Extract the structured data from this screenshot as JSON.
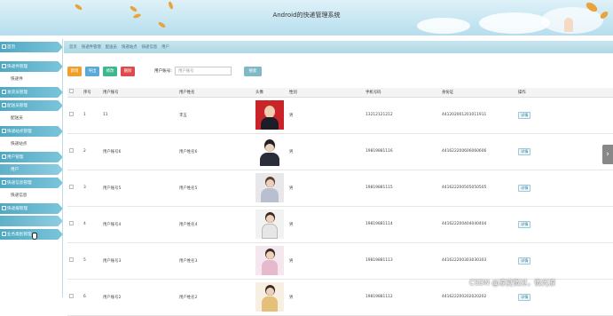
{
  "header": {
    "title": "Android的快递管理系统"
  },
  "sidebar": {
    "groups": [
      {
        "label": "首页",
        "items": []
      },
      {
        "label": "快递件管理",
        "items": [
          "快递件"
        ]
      },
      {
        "label": "发货员管理",
        "items": []
      },
      {
        "label": "配送员管理",
        "items": [
          "配送员"
        ]
      },
      {
        "label": "快递站点管理",
        "items": [
          "快递站点"
        ]
      },
      {
        "label": "用户管理",
        "items": [
          "用户"
        ]
      },
      {
        "label": "快递信息管理",
        "items": [
          "快递信息"
        ]
      },
      {
        "label": "快递报管理",
        "items": [
          ""
        ]
      },
      {
        "label": "业务类别管理",
        "items": []
      }
    ]
  },
  "breadcrumb": [
    "首页",
    "快递件管理",
    "配送员",
    "快递站点",
    "快递信息",
    "用户"
  ],
  "toolbar": {
    "buttons": [
      {
        "label": "新增",
        "color": "#f0a028"
      },
      {
        "label": "导出",
        "color": "#5aa9d6"
      },
      {
        "label": "修改",
        "color": "#3cb88c"
      },
      {
        "label": "删除",
        "color": "#e04a4a"
      }
    ],
    "search_label": "用户账号:",
    "search_placeholder": "用户账号",
    "search_button": "搜索"
  },
  "table": {
    "columns": [
      "",
      "序号",
      "用户账号",
      "用户姓名",
      "头像",
      "性别",
      "手机号码",
      "身份证",
      "操作"
    ],
    "rows": [
      {
        "no": "1",
        "account": "11",
        "name": "李五",
        "gender": "男",
        "phone": "13212121212",
        "idcard": "441202001201011911",
        "action": "详情"
      },
      {
        "no": "2",
        "account": "用户账号6",
        "name": "用户姓名6",
        "gender": "男",
        "phone": "19819881116",
        "idcard": "441622200606060606",
        "action": "详情"
      },
      {
        "no": "3",
        "account": "用户账号5",
        "name": "用户姓名5",
        "gender": "男",
        "phone": "19819881115",
        "idcard": "441622200505050505",
        "action": "详情"
      },
      {
        "no": "4",
        "account": "用户账号4",
        "name": "用户姓名4",
        "gender": "男",
        "phone": "19819881114",
        "idcard": "441622200404040404",
        "action": "详情"
      },
      {
        "no": "5",
        "account": "用户账号3",
        "name": "用户姓名3",
        "gender": "男",
        "phone": "19819881113",
        "idcard": "441622200303030303",
        "action": "详情"
      },
      {
        "no": "6",
        "account": "用户账号2",
        "name": "用户姓名2",
        "gender": "男",
        "phone": "19819881112",
        "idcard": "441622200202020202",
        "action": "详情"
      }
    ]
  },
  "watermark": "CSDN @凉夏微过，微光凉",
  "colors": {
    "accent": "#5eb0c9",
    "header_bg": "#c6e6f2"
  }
}
